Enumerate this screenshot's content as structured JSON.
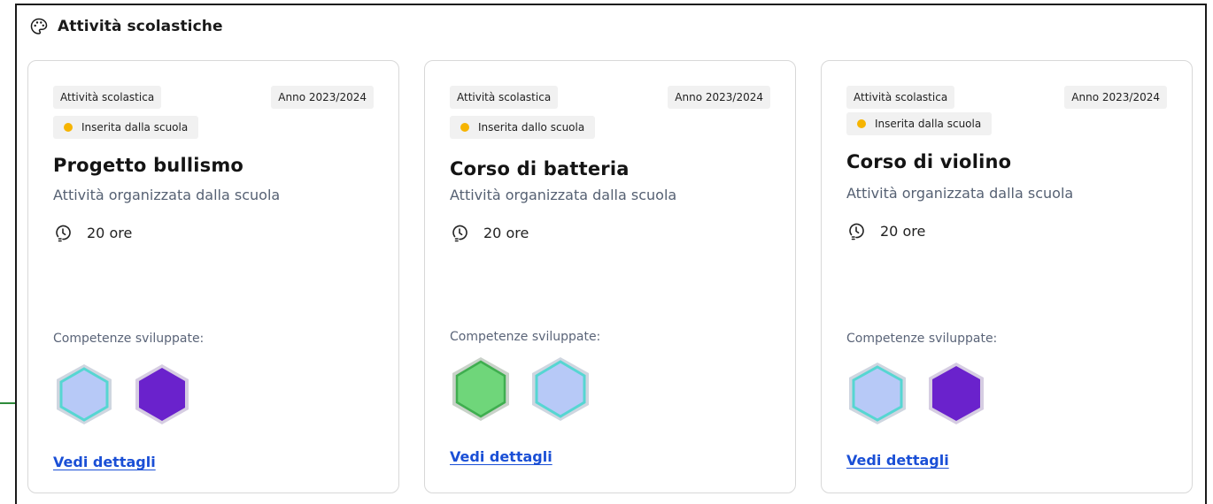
{
  "section": {
    "title": "Attività scolastiche",
    "icon": "palette-icon"
  },
  "cards": [
    {
      "type_tag": "Attività scolastica",
      "year_tag": "Anno 2023/2024",
      "status": "Inserita dalla scuola",
      "status_color": "#f6b400",
      "title": "Progetto bullismo",
      "subtitle": "Attività organizzata dalla scuola",
      "hours": "20 ore",
      "competenze_label": "Competenze sviluppate:",
      "competenze": [
        "light-blue-hexagon",
        "purple-hexagon"
      ],
      "link": "Vedi dettagli"
    },
    {
      "type_tag": "Attività scolastica",
      "year_tag": "Anno 2023/2024",
      "status": "Inserita dallo scuola",
      "status_color": "#f6b400",
      "title": "Corso di batteria",
      "subtitle": "Attività organizzata dalla scuola",
      "hours": "20 ore",
      "competenze_label": "Competenze sviluppate:",
      "competenze": [
        "green-hexagon",
        "light-blue-hexagon"
      ],
      "link": "Vedi dettagli"
    },
    {
      "type_tag": "Attività scolastica",
      "year_tag": "Anno 2023/2024",
      "status": "Inserita dalla scuola",
      "status_color": "#f6b400",
      "title": "Corso di violino",
      "subtitle": "Attività organizzata dalla scuola",
      "hours": "20 ore",
      "competenze_label": "Competenze sviluppate:",
      "competenze": [
        "light-blue-hexagon",
        "purple-hexagon"
      ],
      "link": "Vedi dettagli"
    }
  ],
  "colors": {
    "link": "#1a4fd6",
    "hex_light_blue": "#b7c9f7",
    "hex_purple": "#6a22cc",
    "hex_green": "#6fd67a"
  }
}
